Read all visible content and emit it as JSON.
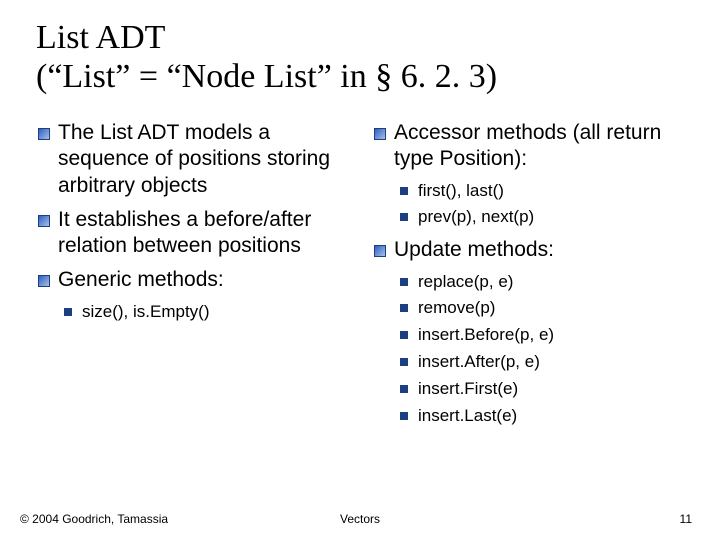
{
  "title": "List ADT\n(“List” = “Node List” in § 6. 2. 3)",
  "left": {
    "items": [
      "The List ADT models a sequence of positions storing arbitrary objects",
      "It establishes a before/after relation between positions",
      "Generic methods:"
    ],
    "generic_methods": [
      "size(), is.Empty()"
    ]
  },
  "right": {
    "items": [
      "Accessor methods (all return type Position):",
      "Update methods:"
    ],
    "accessor_methods": [
      "first(), last()",
      "prev(p), next(p)"
    ],
    "update_methods": [
      "replace(p, e)",
      "remove(p)",
      "insert.Before(p, e)",
      "insert.After(p, e)",
      "insert.First(e)",
      "insert.Last(e)"
    ]
  },
  "footer": {
    "copyright": "© 2004 Goodrich, Tamassia",
    "center": "Vectors",
    "pagenum": "11"
  }
}
